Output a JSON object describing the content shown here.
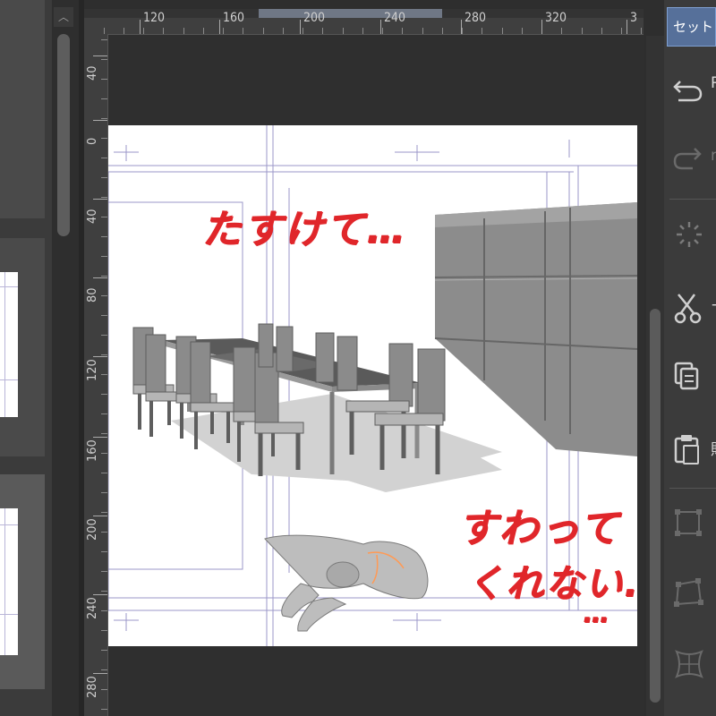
{
  "left_panel": {
    "scroll_up_arrow": "︿"
  },
  "ruler_top": {
    "labels": [
      "120",
      "160",
      "200",
      "240",
      "280",
      "320",
      "3"
    ]
  },
  "ruler_left": {
    "labels": [
      "40",
      "0",
      "40",
      "80",
      "120",
      "160",
      "200",
      "240",
      "280"
    ]
  },
  "canvas": {
    "text_help": "たすけて…",
    "text_wont_sit_1": "すわって",
    "text_wont_sit_2": "くれない…",
    "text_trailing_dots": "…"
  },
  "command_bar": {
    "set_label": "セット",
    "tools": [
      {
        "name": "undo-icon",
        "peek": "R"
      },
      {
        "name": "redo-icon",
        "peek": "r"
      },
      {
        "name": "loading-icon",
        "peek": ""
      },
      {
        "name": "cut-icon",
        "peek": "+"
      },
      {
        "name": "copy-icon",
        "peek": ""
      },
      {
        "name": "paste-icon",
        "peek": "貼"
      },
      {
        "name": "transform-icon",
        "peek": ""
      },
      {
        "name": "free-transform-icon",
        "peek": ""
      },
      {
        "name": "mesh-transform-icon",
        "peek": ""
      }
    ]
  },
  "colors": {
    "app_background": "#2e2e2e",
    "panel": "#3b3b3b",
    "accent_button": "#56709a",
    "guide_lines": "#9b97c8",
    "handwriting": "#e0262a"
  }
}
